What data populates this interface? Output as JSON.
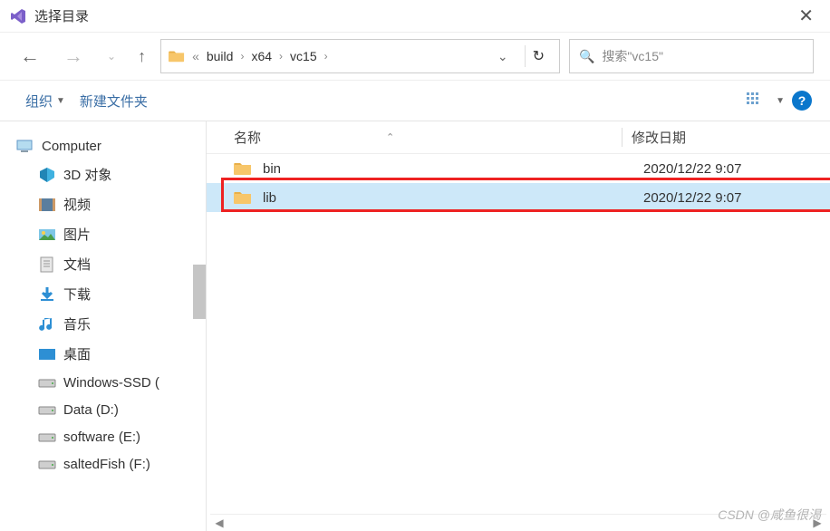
{
  "window": {
    "title": "选择目录"
  },
  "breadcrumb": {
    "parts": [
      "build",
      "x64",
      "vc15"
    ]
  },
  "search": {
    "placeholder": "搜索\"vc15\""
  },
  "toolbar": {
    "organize": "组织",
    "new_folder": "新建文件夹"
  },
  "columns": {
    "name": "名称",
    "date": "修改日期"
  },
  "sidebar": {
    "computer": "Computer",
    "items": [
      {
        "label": "3D 对象",
        "icon": "3d"
      },
      {
        "label": "视频",
        "icon": "video"
      },
      {
        "label": "图片",
        "icon": "pic"
      },
      {
        "label": "文档",
        "icon": "doc"
      },
      {
        "label": "下载",
        "icon": "down"
      },
      {
        "label": "音乐",
        "icon": "music"
      },
      {
        "label": "桌面",
        "icon": "desk"
      },
      {
        "label": "Windows-SSD (",
        "icon": "drive"
      },
      {
        "label": "Data (D:)",
        "icon": "drive"
      },
      {
        "label": "software (E:)",
        "icon": "drive"
      },
      {
        "label": "saltedFish (F:)",
        "icon": "drive"
      }
    ]
  },
  "files": [
    {
      "name": "bin",
      "date": "2020/12/22 9:07",
      "selected": false
    },
    {
      "name": "lib",
      "date": "2020/12/22 9:07",
      "selected": true
    }
  ],
  "watermark": "CSDN @咸鱼很渴"
}
